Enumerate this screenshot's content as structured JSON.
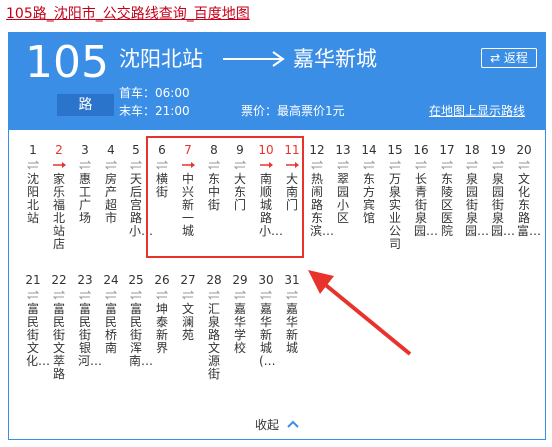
{
  "page": {
    "link_text": "105路_沈阳市_公交路线查询_百度地图"
  },
  "route": {
    "number": "105",
    "badge": "路",
    "from": "沈阳北站",
    "to": "嘉华新城",
    "reverse_label": "⇄ 返程",
    "first_bus": "首车：06:00",
    "last_bus": "末车：21:00",
    "fare": "票价：最高票价1元",
    "map_link": "在地图上显示路线"
  },
  "stops": [
    {
      "num": "1",
      "name": "沈阳北站",
      "hl": false
    },
    {
      "num": "2",
      "name": "家乐福北站店",
      "hl": true
    },
    {
      "num": "3",
      "name": "惠工广场",
      "hl": false
    },
    {
      "num": "4",
      "name": "房产超市",
      "hl": false
    },
    {
      "num": "5",
      "name": "天后宫路小…",
      "hl": false
    },
    {
      "num": "6",
      "name": "横街",
      "hl": false
    },
    {
      "num": "7",
      "name": "中兴新一城",
      "hl": true
    },
    {
      "num": "8",
      "name": "东中街",
      "hl": false
    },
    {
      "num": "9",
      "name": "大东门",
      "hl": false
    },
    {
      "num": "10",
      "name": "南顺城路小…",
      "hl": true
    },
    {
      "num": "11",
      "name": "大南门",
      "hl": true
    },
    {
      "num": "12",
      "name": "热闹路东滨…",
      "hl": false
    },
    {
      "num": "13",
      "name": "翠园小区",
      "hl": false
    },
    {
      "num": "14",
      "name": "东方宾馆",
      "hl": false
    },
    {
      "num": "15",
      "name": "万泉实业公司",
      "hl": false
    },
    {
      "num": "16",
      "name": "长青街泉园…",
      "hl": false
    },
    {
      "num": "17",
      "name": "东陵区医院",
      "hl": false
    },
    {
      "num": "18",
      "name": "泉园街泉园…",
      "hl": false
    },
    {
      "num": "19",
      "name": "泉园街泉园…",
      "hl": false
    },
    {
      "num": "20",
      "name": "文化东路富…",
      "hl": false
    },
    {
      "num": "21",
      "name": "富民街文化…",
      "hl": false
    },
    {
      "num": "22",
      "name": "富民街文萃路",
      "hl": false
    },
    {
      "num": "23",
      "name": "富民街银河…",
      "hl": false
    },
    {
      "num": "24",
      "name": "富民桥南",
      "hl": false
    },
    {
      "num": "25",
      "name": "富民街浑南…",
      "hl": false
    },
    {
      "num": "26",
      "name": "坤泰新界",
      "hl": false
    },
    {
      "num": "27",
      "name": "文澜苑",
      "hl": false
    },
    {
      "num": "28",
      "name": "汇泉路文源街",
      "hl": false
    },
    {
      "num": "29",
      "name": "嘉华学校",
      "hl": false
    },
    {
      "num": "30",
      "name": "嘉华新城(…",
      "hl": false
    },
    {
      "num": "31",
      "name": "嘉华新城",
      "hl": false
    }
  ],
  "footer": {
    "collapse_label": "收起"
  },
  "colors": {
    "header_bg": "#3a8ee6",
    "badge_bg": "#2a74cc",
    "highlight": "#e8332c",
    "link_red": "#c4001a"
  }
}
